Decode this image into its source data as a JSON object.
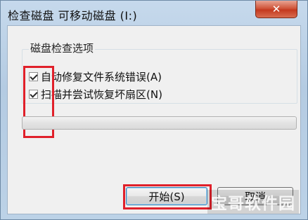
{
  "window": {
    "title": "检查磁盘 可移动磁盘 (I:)",
    "close_label": "✕"
  },
  "options_group": {
    "title": "磁盘检查选项",
    "options": [
      {
        "label": "自动修复文件系统错误(A)",
        "checked": true
      },
      {
        "label": "扫描并尝试恢复坏扇区(N)",
        "checked": true
      }
    ]
  },
  "progress": {
    "value": 0
  },
  "buttons": {
    "start": "开始(S)",
    "cancel": "取消"
  },
  "watermark": "宝哥软件园",
  "colors": {
    "highlight": "#e0202a",
    "titlebar": "#b9cfe4",
    "close": "#c4391f"
  }
}
